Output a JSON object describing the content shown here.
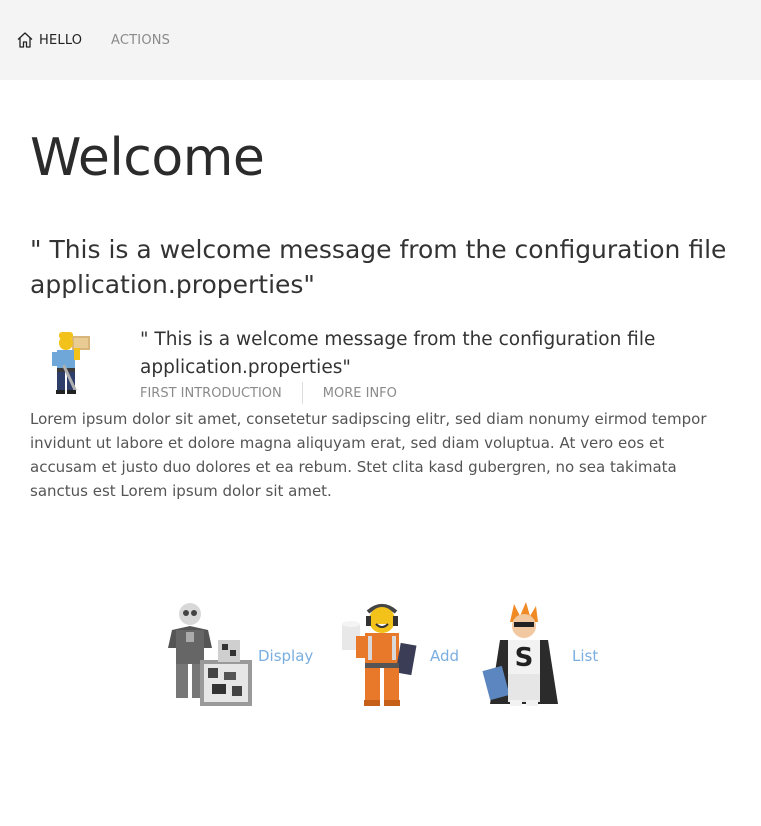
{
  "nav": {
    "home_icon": "home-icon",
    "hello": "HELLO",
    "actions": "ACTIONS"
  },
  "main": {
    "title": "Welcome",
    "message": "\" This is a welcome message from the configuration file application.properties\""
  },
  "card": {
    "image": "lego-worker-figure",
    "message": "\" This is a welcome message from the configuration file application.properties\"",
    "links": [
      "FIRST INTRODUCTION",
      "MORE INFO"
    ]
  },
  "lorem": "Lorem ipsum dolor sit amet, consetetur sadipscing elitr, sed diam nonumy eirmod tempor invidunt ut labore et dolore magna aliquyam erat, sed diam voluptua. At vero eos et accusam et justo duo dolores et ea rebum. Stet clita kasd gubergren, no sea takimata sanctus est Lorem ipsum dolor sit amet.",
  "actions": [
    {
      "label": "Display",
      "image": "lego-skeleton-figure"
    },
    {
      "label": "Add",
      "image": "lego-builder-figure"
    },
    {
      "label": "List",
      "image": "lego-superhero-figure"
    }
  ],
  "colors": {
    "topbar": "#f4f4f4",
    "link": "#7aaee0",
    "muted": "#8a8a8a"
  }
}
